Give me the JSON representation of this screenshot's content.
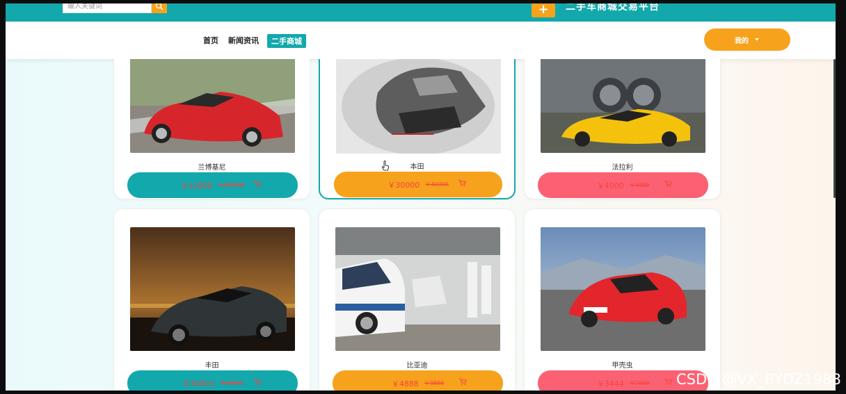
{
  "header": {
    "search_placeholder": "输入关键词",
    "add_icon": "plus-icon",
    "site_title": "二手车商城交易平台"
  },
  "nav": {
    "items": [
      {
        "label": "首页"
      },
      {
        "label": "新闻资讯"
      },
      {
        "label": "二手商城"
      }
    ],
    "mine_label": "我的"
  },
  "products": [
    {
      "name": "兰博基尼",
      "price": "￥12000",
      "old_price": "￥130000",
      "button_color": "#13a8ac"
    },
    {
      "name": "本田",
      "price": "￥30000",
      "old_price": "￥40000",
      "button_color": "#f7a21c"
    },
    {
      "name": "法拉利",
      "price": "￥4000",
      "old_price": "￥4000",
      "button_color": "#fb6172"
    },
    {
      "name": "丰田",
      "price": "￥30003",
      "old_price": "￥40000",
      "button_color": "#13a8ac"
    },
    {
      "name": "比亚迪",
      "price": "￥4888",
      "old_price": "￥3888",
      "button_color": "#f7a21c"
    },
    {
      "name": "甲壳虫",
      "price": "￥3444",
      "old_price": "￥2000",
      "button_color": "#fb6172"
    }
  ],
  "colors": {
    "teal": "#13a8ac",
    "orange": "#f7a21c",
    "pink": "#fb6172",
    "price_red": "#f54242"
  },
  "watermark": "CSDN @VX_BYDZ1988"
}
